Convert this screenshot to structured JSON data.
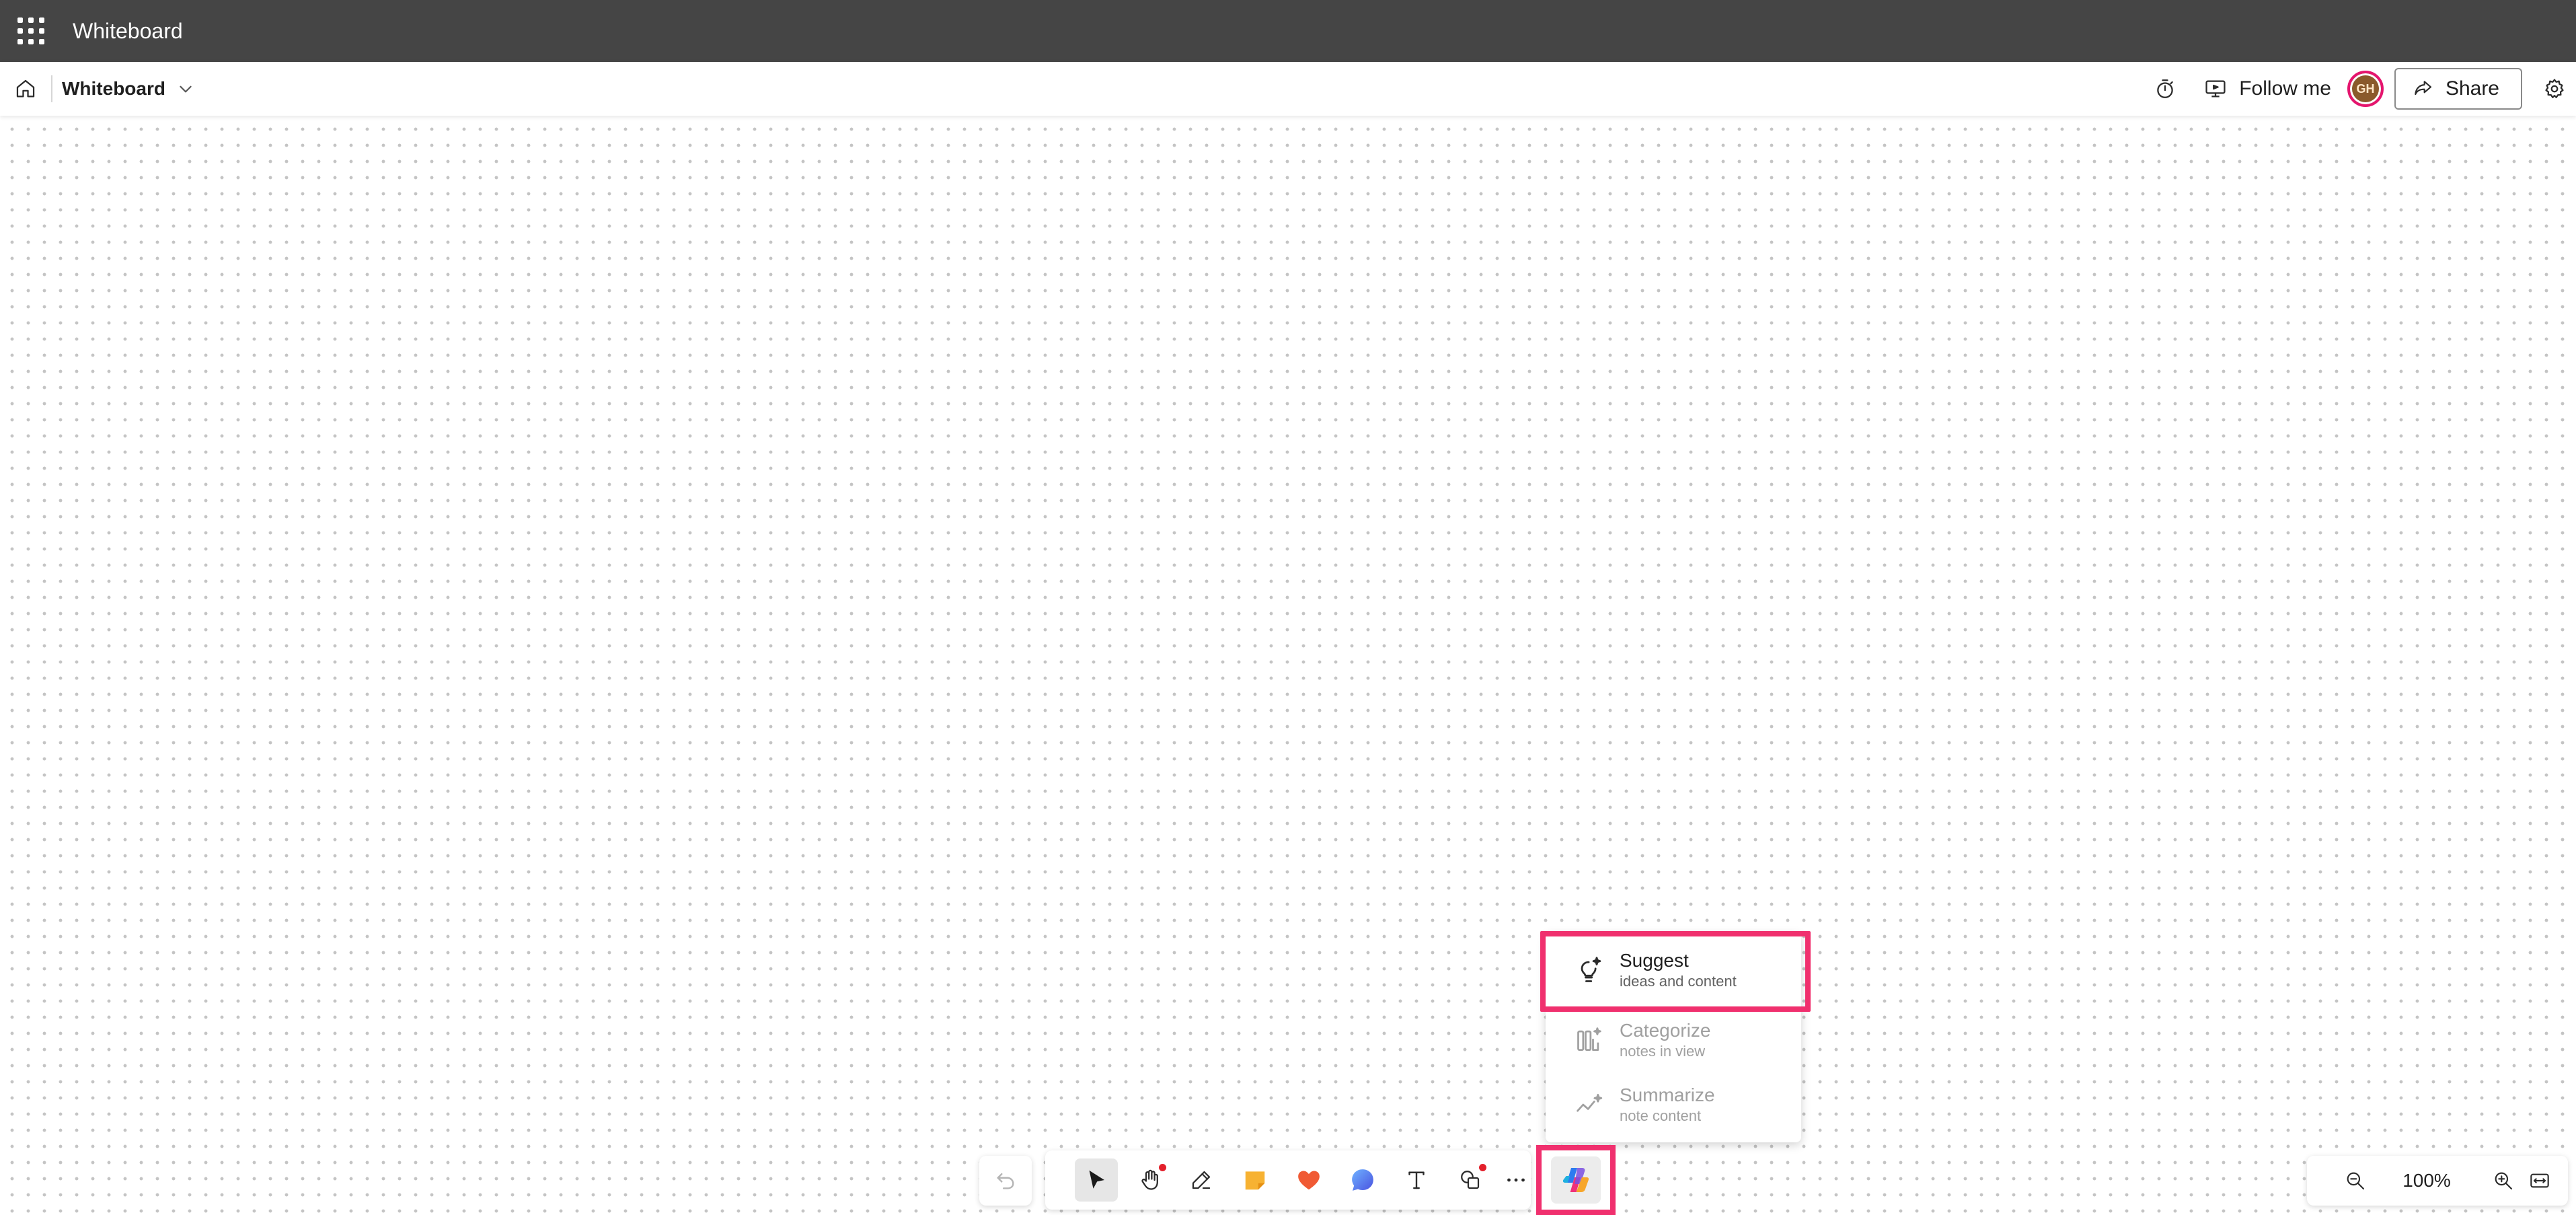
{
  "appbar": {
    "title": "Whiteboard"
  },
  "toolbar": {
    "board_name": "Whiteboard",
    "follow_label": "Follow me",
    "avatar_initials": "GH",
    "share_label": "Share"
  },
  "copilot_menu": {
    "items": [
      {
        "title": "Suggest",
        "subtitle": "ideas and content",
        "enabled": true,
        "icon": "lightbulb-sparkle-icon"
      },
      {
        "title": "Categorize",
        "subtitle": "notes in view",
        "enabled": false,
        "icon": "categorize-icon"
      },
      {
        "title": "Summarize",
        "subtitle": "note content",
        "enabled": false,
        "icon": "summarize-icon"
      }
    ]
  },
  "bottom_tools": [
    {
      "name": "select",
      "icon": "pointer-icon",
      "active": true
    },
    {
      "name": "pan",
      "icon": "hand-icon",
      "badge": true
    },
    {
      "name": "pen",
      "icon": "pen-icon"
    },
    {
      "name": "sticky-note",
      "icon": "sticky-note-icon"
    },
    {
      "name": "reactions",
      "icon": "heart-icon"
    },
    {
      "name": "comment",
      "icon": "comment-icon"
    },
    {
      "name": "text",
      "icon": "text-icon"
    },
    {
      "name": "shapes",
      "icon": "shapes-icon",
      "badge": true
    },
    {
      "name": "more",
      "icon": "more-icon"
    }
  ],
  "zoom": {
    "value": "100%"
  },
  "colors": {
    "appbar": "#454545",
    "highlight": "#f0306e",
    "badge": "#e3202b",
    "sticky": "#f7b232",
    "heart": "#f05a34",
    "comment": "#4f7ff0"
  }
}
